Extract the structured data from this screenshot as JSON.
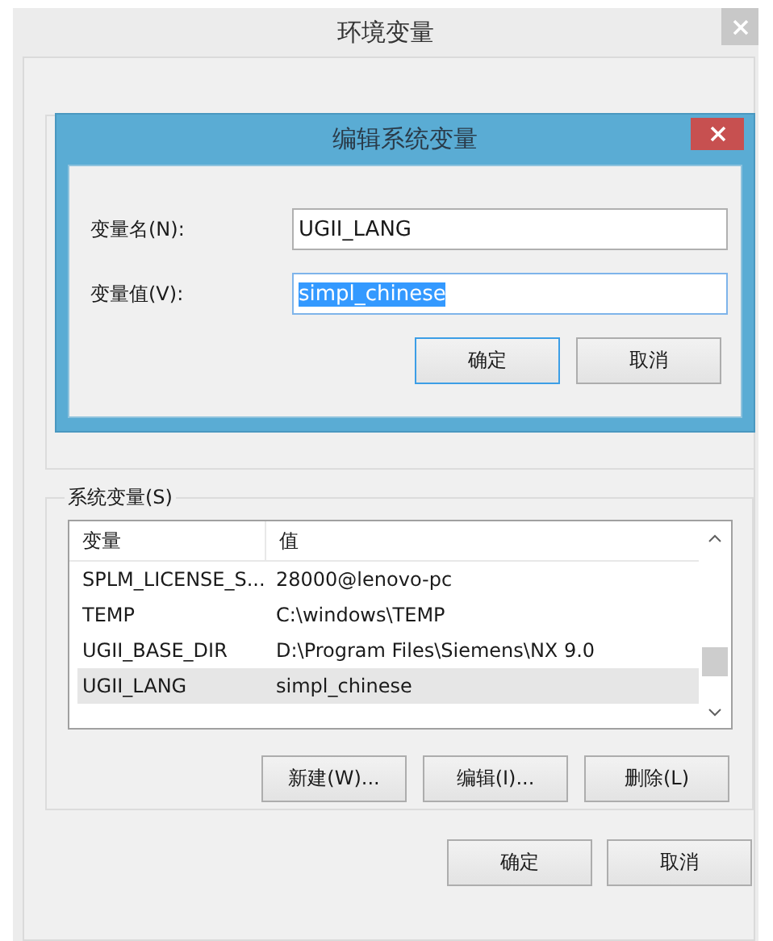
{
  "window": {
    "title": "环境变量"
  },
  "dialog": {
    "title": "编辑系统变量",
    "fields": [
      {
        "label": "变量名(N):",
        "value": "UGII_LANG",
        "selected": false
      },
      {
        "label": "变量值(V):",
        "value": "simpl_chinese",
        "selected": true
      }
    ],
    "buttons": [
      {
        "label": "确定",
        "default": true
      },
      {
        "label": "取消",
        "default": false
      }
    ]
  },
  "system_variables": {
    "title": "系统变量(S)",
    "columns": [
      "变量",
      "值"
    ],
    "rows": [
      {
        "cells": [
          "SPLM_LICENSE_S...",
          "28000@lenovo-pc"
        ],
        "selected": false
      },
      {
        "cells": [
          "TEMP",
          "C:\\windows\\TEMP"
        ],
        "selected": false
      },
      {
        "cells": [
          "UGII_BASE_DIR",
          "D:\\Program Files\\Siemens\\NX 9.0"
        ],
        "selected": false
      },
      {
        "cells": [
          "UGII_LANG",
          "simpl_chinese"
        ],
        "selected": true
      }
    ],
    "buttons": [
      {
        "label": "新建(W)..."
      },
      {
        "label": "编辑(I)..."
      },
      {
        "label": "删除(L)"
      }
    ]
  },
  "buttons": [
    {
      "label": "确定",
      "default": false
    },
    {
      "label": "取消",
      "default": false
    }
  ]
}
